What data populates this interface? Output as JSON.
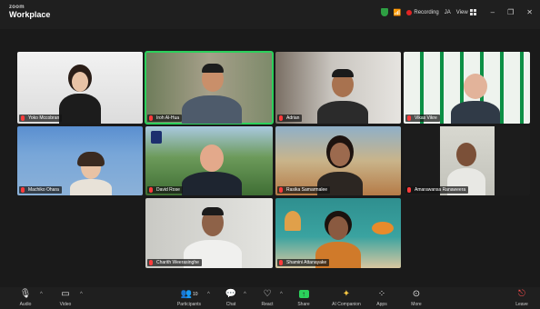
{
  "app": {
    "brand_top": "zoom",
    "brand_bottom": "Workplace"
  },
  "titlebar": {
    "recording": "Recording",
    "initials": "JA",
    "view_label": "View",
    "minimize": "–",
    "restore": "❐",
    "close": "✕"
  },
  "participants": [
    {
      "name": "Yoko Mccobran"
    },
    {
      "name": "Iroh Al-Hua"
    },
    {
      "name": "Adrian"
    },
    {
      "name": "Vikas Vikre"
    },
    {
      "name": "Machiko Ohara"
    },
    {
      "name": "David Rose"
    },
    {
      "name": "Rasika Samarmalee"
    },
    {
      "name": "Amarawansa Ranaweera"
    },
    {
      "name": "Charith Weerasinghe"
    },
    {
      "name": "Shamini Attanayake"
    }
  ],
  "toolbar": {
    "audio": "Audio",
    "video": "Video",
    "participants": "Participants",
    "participants_count": "10",
    "chat": "Chat",
    "react": "React",
    "share": "Share",
    "ai_companion": "AI Companion",
    "apps": "Apps",
    "more": "More",
    "leave": "Leave"
  },
  "colors": {
    "active_speaker": "#2bd05b",
    "recording": "#e02424",
    "leave": "#e02424"
  }
}
